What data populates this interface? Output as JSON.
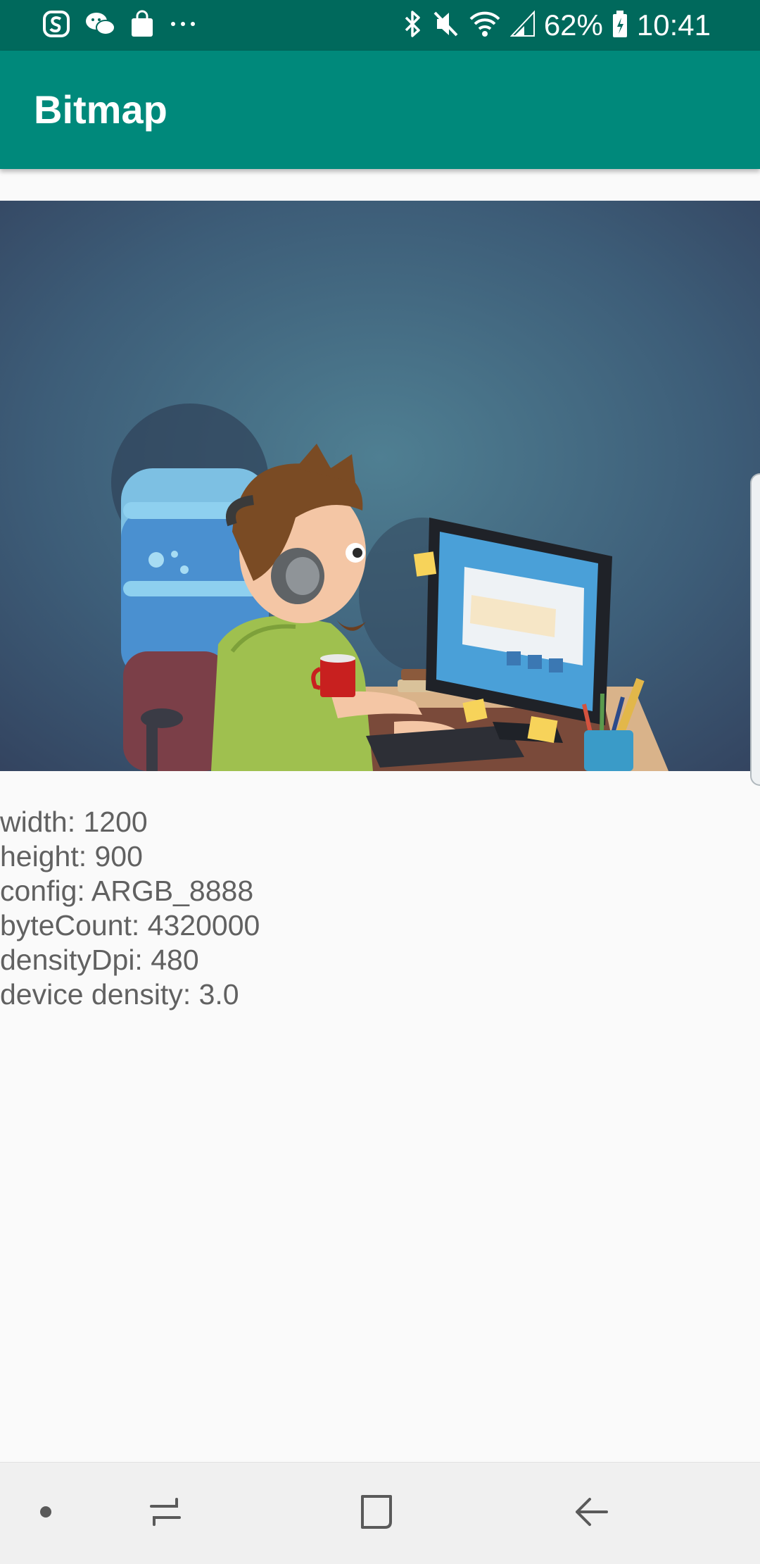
{
  "status_bar": {
    "battery_percent": "62%",
    "time": "10:41",
    "notification_icons": [
      "swiftkey-icon",
      "wechat-icon",
      "shopping-bag-icon",
      "more-dots-icon"
    ],
    "system_icons": [
      "bluetooth-icon",
      "mute-icon",
      "wifi-icon",
      "signal-icon",
      "battery-icon"
    ]
  },
  "app_bar": {
    "title": "Bitmap"
  },
  "image": {
    "subject_icon": "illustration-person-at-computer"
  },
  "info": {
    "lines": [
      "width: 1200",
      "height: 900",
      "config: ARGB_8888",
      "byteCount: 4320000",
      "densityDpi: 480",
      "device density: 3.0"
    ]
  },
  "nav_bar": {
    "buttons": [
      "dot-icon",
      "recents-icon",
      "home-icon",
      "back-icon"
    ]
  },
  "colors": {
    "status_bar": "#00695c",
    "app_bar": "#00897b",
    "background": "#fafafa",
    "info_text": "#616161"
  }
}
